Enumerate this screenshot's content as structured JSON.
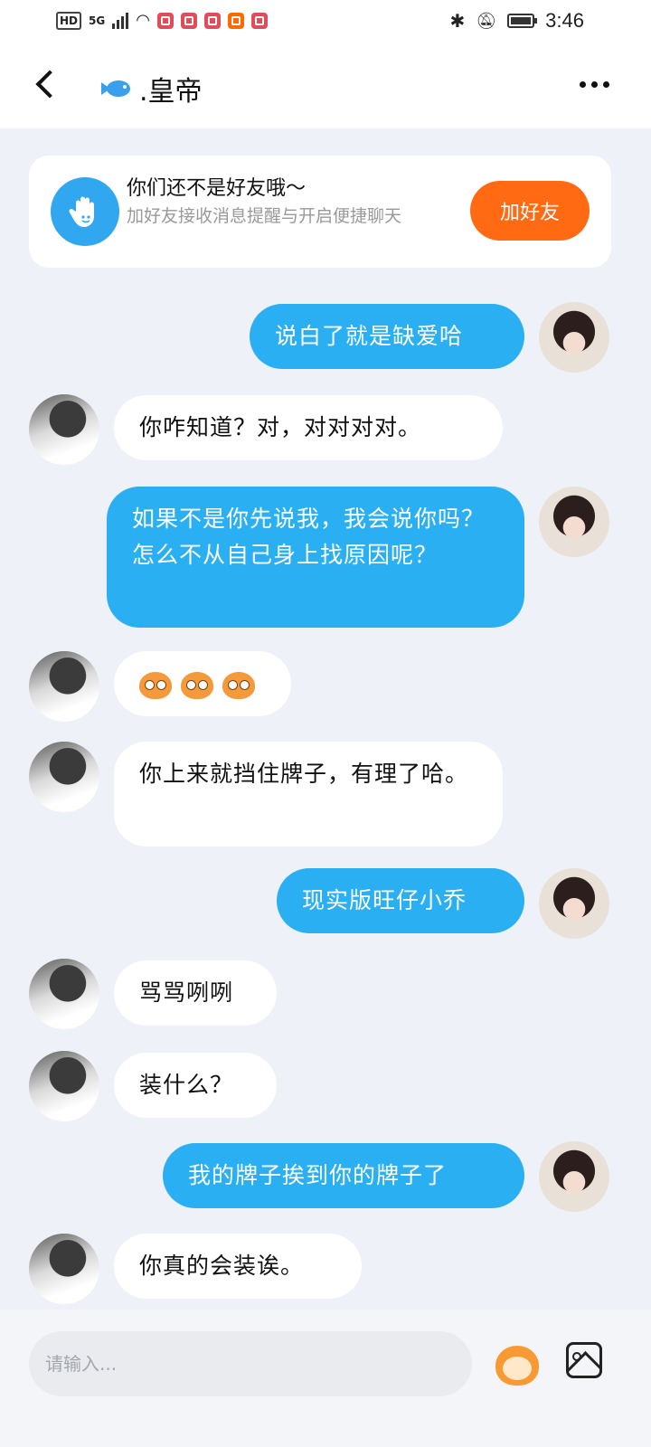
{
  "status_bar": {
    "network": "HD",
    "signal": "5G",
    "time": "3:46"
  },
  "header": {
    "title": ".皇帝"
  },
  "friend_prompt": {
    "title": "你们还不是好友哦～",
    "subtitle": "加好友接收消息提醒与开启便捷聊天",
    "button": "加好友"
  },
  "messages": [
    {
      "side": "out",
      "text": "说白了就是缺爱哈"
    },
    {
      "side": "in",
      "text": "你咋知道？对，对对对对。"
    },
    {
      "side": "out",
      "text": "如果不是你先说我，我会说你吗？怎么不从自己身上找原因呢？"
    },
    {
      "side": "in",
      "text": "[monkey x3]"
    },
    {
      "side": "in",
      "text": "你上来就挡住牌子，有理了哈。"
    },
    {
      "side": "out",
      "text": "现实版旺仔小乔"
    },
    {
      "side": "in",
      "text": "骂骂咧咧"
    },
    {
      "side": "in",
      "text": "装什么？"
    },
    {
      "side": "out",
      "text": "我的牌子挨到你的牌子了"
    },
    {
      "side": "in",
      "text": "你真的会装诶。"
    }
  ],
  "composer": {
    "placeholder": "请输入..."
  },
  "icons": {
    "back": "back-arrow-icon",
    "more": "more-dots-icon",
    "emoji": "monkey-emoji-icon",
    "image": "image-icon",
    "wave": "wave-hand-icon"
  },
  "colors": {
    "outgoing_bubble": "#2ab0f2",
    "add_friend_button": "#ff6a13"
  }
}
